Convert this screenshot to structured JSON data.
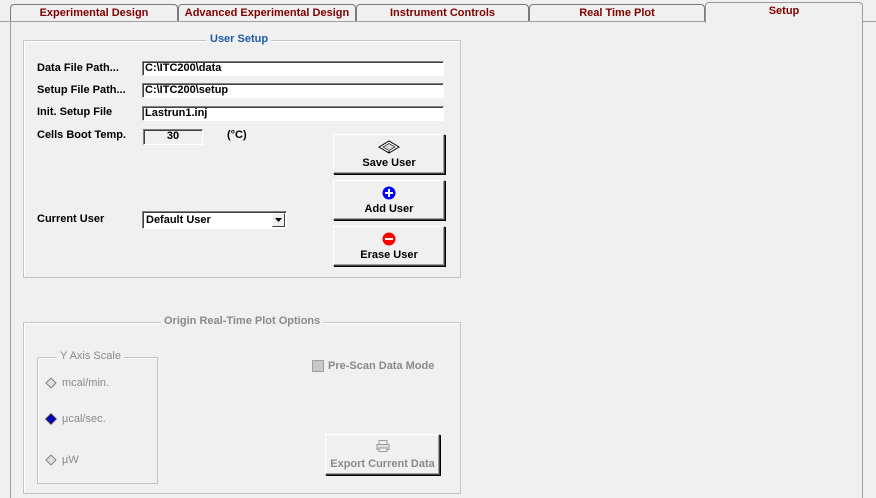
{
  "tabs": [
    {
      "label": "Experimental Design",
      "active": false
    },
    {
      "label": "Advanced Experimental Design",
      "active": false
    },
    {
      "label": "Instrument Controls",
      "active": false
    },
    {
      "label": "Real Time Plot",
      "active": false
    },
    {
      "label": "Setup",
      "active": true
    }
  ],
  "user_setup": {
    "title": "User Setup",
    "data_path_label": "Data File Path...",
    "data_path_value": "C:\\ITC200\\data",
    "setup_path_label": "Setup File Path...",
    "setup_path_value": "C:\\ITC200\\setup",
    "init_file_label": "Init. Setup File",
    "init_file_value": "Lastrun1.inj",
    "boot_temp_label": "Cells Boot Temp.",
    "boot_temp_value": "30",
    "boot_temp_unit": "(°C)",
    "current_user_label": "Current User",
    "current_user_value": "Default User",
    "save_user": "Save User",
    "add_user": "Add User",
    "erase_user": "Erase User"
  },
  "plot_options": {
    "title": "Origin Real-Time Plot Options",
    "y_axis_title": "Y Axis Scale",
    "y_axis_options": [
      {
        "label": "mcal/min.",
        "selected": false
      },
      {
        "label": "µcal/sec.",
        "selected": true
      },
      {
        "label": "µW",
        "selected": false
      }
    ],
    "prescan_label": "Pre-Scan Data Mode",
    "export_label": "Export Current Data"
  },
  "colors": {
    "tab_text": "#800000",
    "group_title": "#1e5aa8",
    "add_icon": "#0000ff",
    "erase_icon": "#ff0000"
  }
}
